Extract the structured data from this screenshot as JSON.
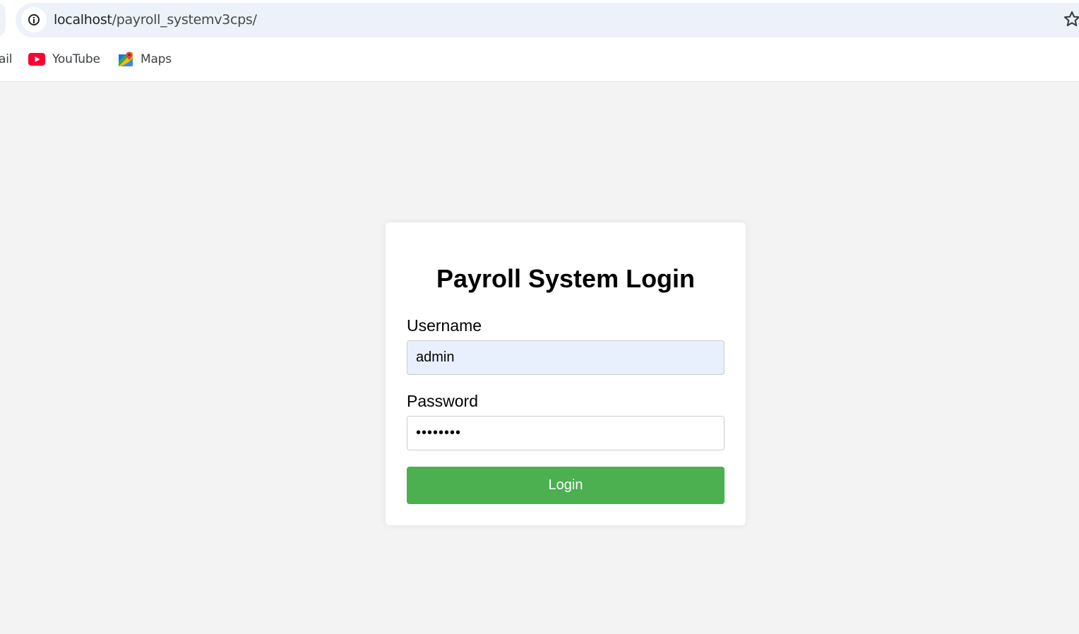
{
  "browser": {
    "url_host": "localhost",
    "url_path": "/payroll_systemv3cps/",
    "bookmarks": [
      {
        "label": "ail",
        "icon": "gmail-icon"
      },
      {
        "label": "YouTube",
        "icon": "youtube-icon"
      },
      {
        "label": "Maps",
        "icon": "maps-icon"
      }
    ]
  },
  "login": {
    "title": "Payroll System Login",
    "username_label": "Username",
    "username_value": "admin",
    "password_label": "Password",
    "password_value": "••••••••",
    "button_label": "Login"
  },
  "colors": {
    "page_background": "#f3f3f3",
    "card_background": "#ffffff",
    "button_green": "#4caf50",
    "autofill_blue": "#e8f0fe",
    "address_bar": "#edf2fa"
  }
}
